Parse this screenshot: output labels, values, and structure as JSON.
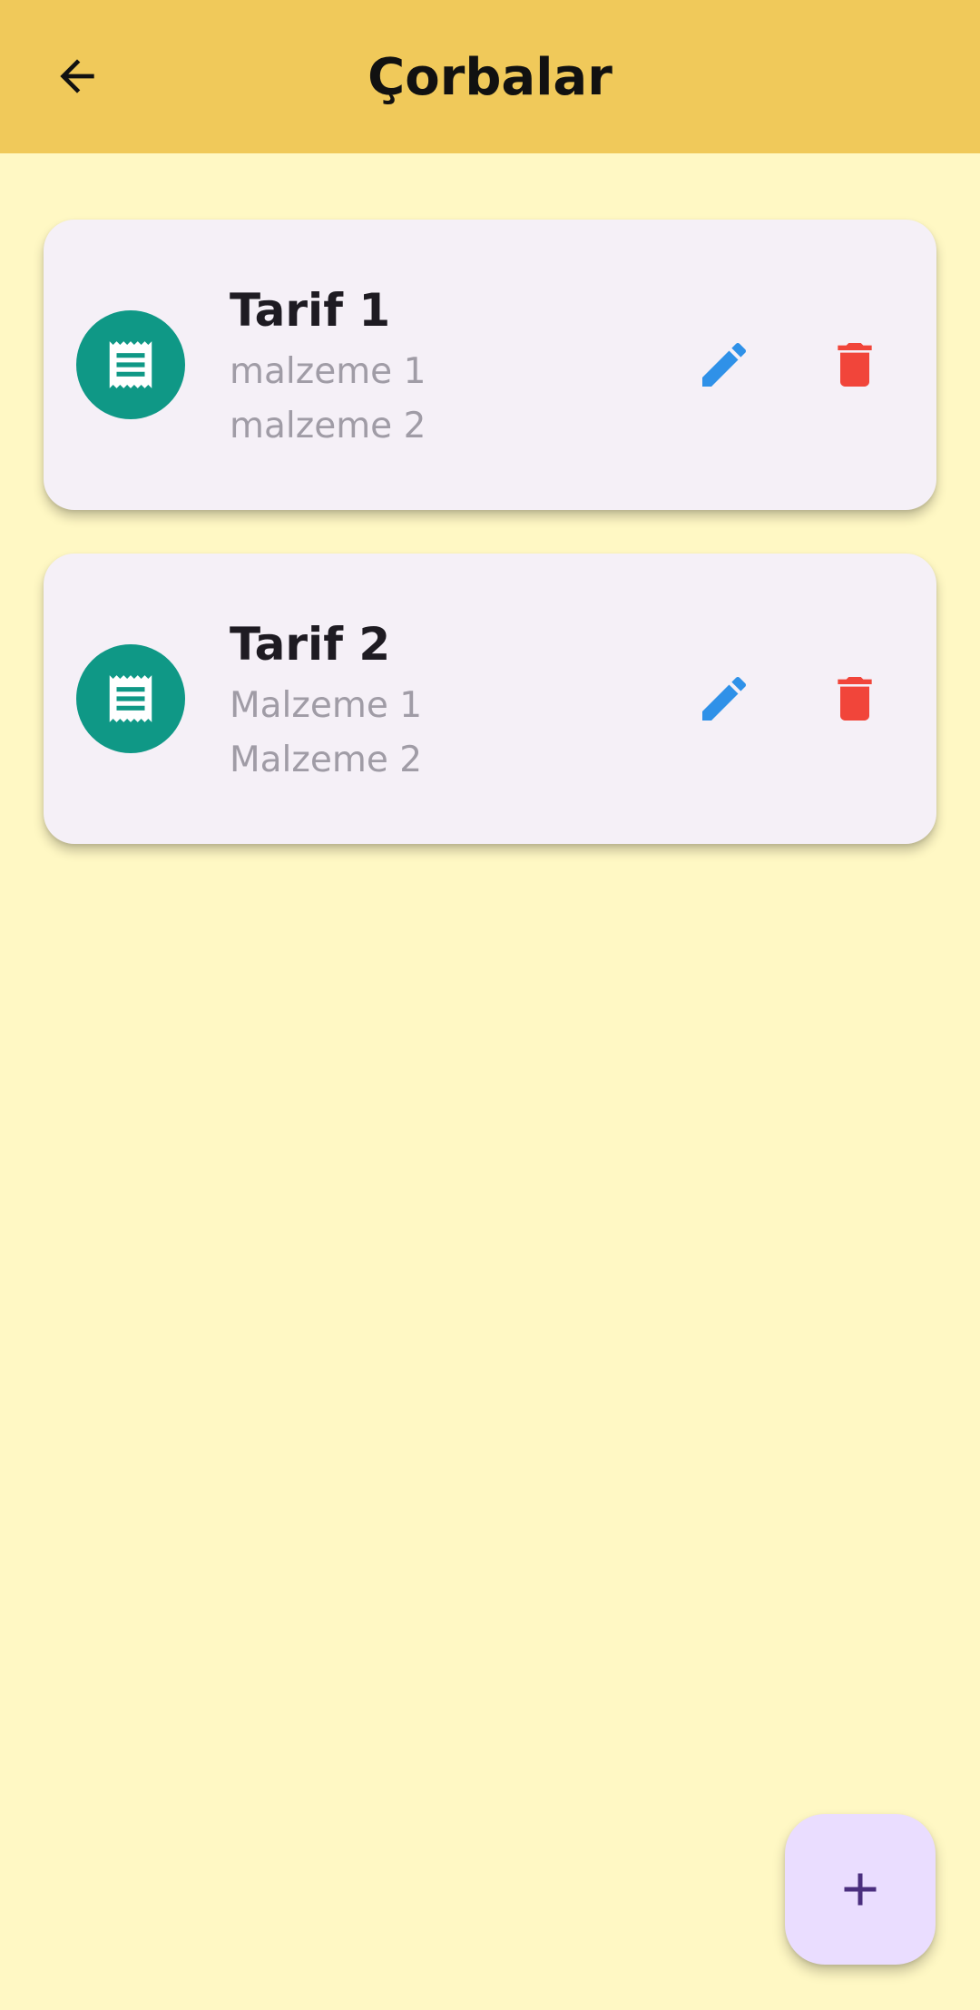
{
  "app_bar": {
    "title": "Çorbalar",
    "background": "#F0C95A",
    "back_icon": "arrow-back-icon"
  },
  "screen_background": "#FFF8C4",
  "recipes": [
    {
      "title": "Tarif 1",
      "ingredients": [
        "malzeme 1",
        "malzeme 2"
      ],
      "icon": "receipt-icon",
      "actions": {
        "edit_icon": "edit-icon",
        "delete_icon": "delete-icon"
      }
    },
    {
      "title": "Tarif 2",
      "ingredients": [
        "Malzeme 1",
        "Malzeme 2"
      ],
      "icon": "receipt-icon",
      "actions": {
        "edit_icon": "edit-icon",
        "delete_icon": "delete-icon"
      }
    }
  ],
  "fab": {
    "icon": "add-icon",
    "background": "#EADDFF"
  },
  "colors": {
    "avatar": "#0F9886",
    "edit": "#2F91E8",
    "delete": "#F1453A",
    "card": "#F5F0F7",
    "fab_icon": "#4A2E7E"
  }
}
